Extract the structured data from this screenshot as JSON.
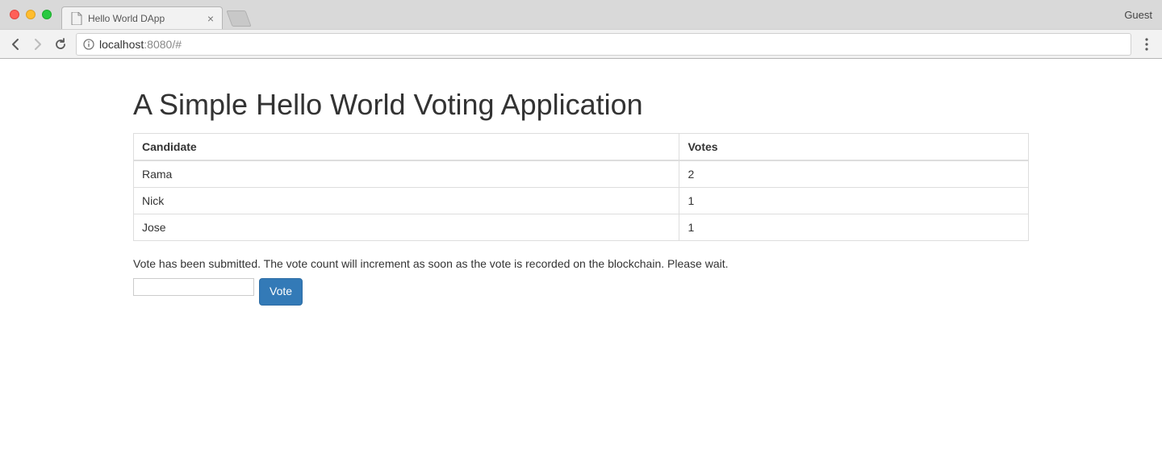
{
  "browser": {
    "tab_title": "Hello World DApp",
    "guest_label": "Guest",
    "url": {
      "host": "localhost",
      "port": ":8080",
      "path": "/#"
    }
  },
  "page": {
    "heading": "A Simple Hello World Voting Application",
    "table": {
      "headers": {
        "candidate": "Candidate",
        "votes": "Votes"
      },
      "rows": [
        {
          "candidate": "Rama",
          "votes": "2"
        },
        {
          "candidate": "Nick",
          "votes": "1"
        },
        {
          "candidate": "Jose",
          "votes": "1"
        }
      ]
    },
    "status_message": "Vote has been submitted. The vote count will increment as soon as the vote is recorded on the blockchain. Please wait.",
    "vote_button_label": "Vote",
    "candidate_input_value": ""
  }
}
